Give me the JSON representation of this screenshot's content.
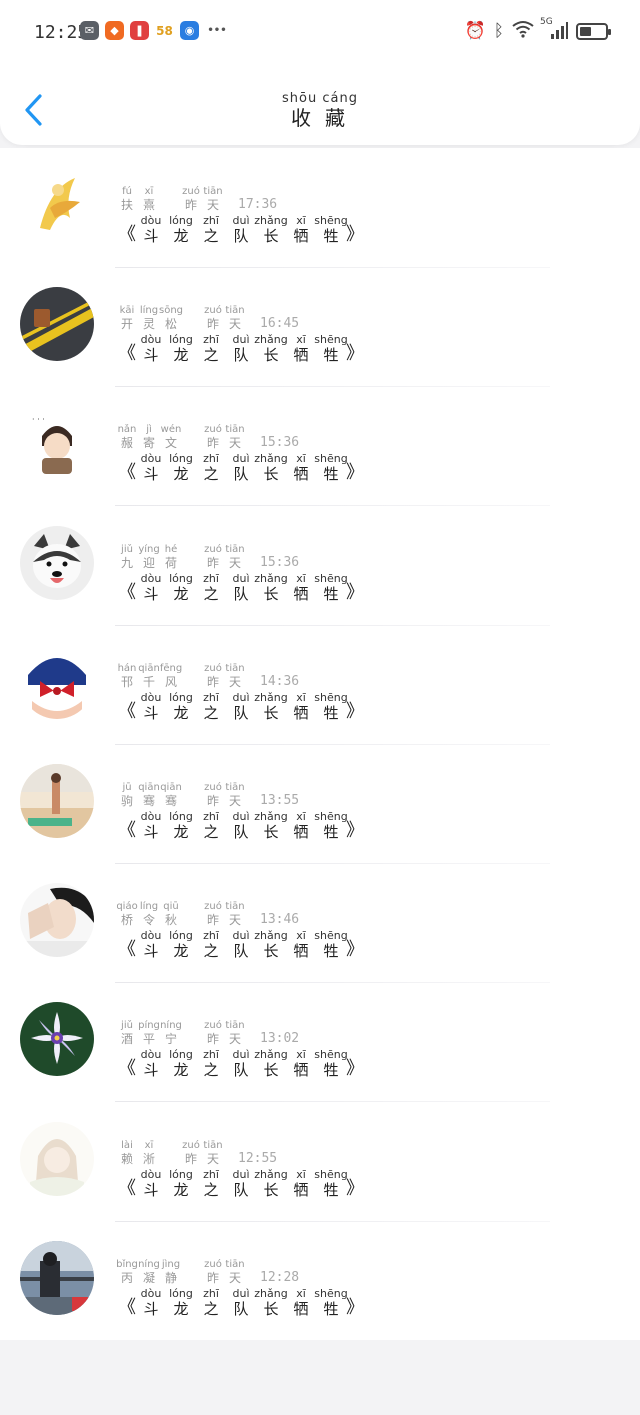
{
  "status_bar": {
    "time": "12:25",
    "left_icons": [
      {
        "name": "mail-app-icon",
        "glyph": "✉",
        "bg": "#5a5f66"
      },
      {
        "name": "kuaishou-app-icon",
        "glyph": "◆",
        "bg": "#f06a22"
      },
      {
        "name": "reader-app-icon",
        "glyph": "❚",
        "bg": "#e04040"
      },
      {
        "name": "58-app-icon",
        "glyph": "58",
        "bg": "#ffffff"
      },
      {
        "name": "bulb-app-icon",
        "glyph": "◉",
        "bg": "#2a7de1"
      },
      {
        "name": "more-dots-icon",
        "glyph": "•••",
        "bg": "transparent"
      }
    ],
    "right_icons": [
      "alarm-icon",
      "bluetooth-icon",
      "wifi-icon",
      "5g-signal-icon",
      "battery-icon"
    ],
    "network_label": "5G"
  },
  "header": {
    "title_pinyin": "shōu cáng",
    "title": "收藏"
  },
  "book": {
    "open": "《",
    "close": "》",
    "chars": [
      {
        "py": "dòu",
        "hz": "斗"
      },
      {
        "py": "lóng",
        "hz": "龙"
      },
      {
        "py": "zhī",
        "hz": "之"
      },
      {
        "py": "duì",
        "hz": "队"
      },
      {
        "py": "zhǎng",
        "hz": "长"
      },
      {
        "py": "xī",
        "hz": "牺"
      },
      {
        "py": "shēng",
        "hz": "牲"
      }
    ]
  },
  "yesterday": [
    {
      "py": "zuó",
      "hz": "昨"
    },
    {
      "py": "tiān",
      "hz": "天"
    }
  ],
  "items": [
    {
      "name": [
        {
          "py": "fú",
          "hz": "扶"
        },
        {
          "py": "xī",
          "hz": "熹"
        }
      ],
      "time": "17:36",
      "avatar": "gold-figure"
    },
    {
      "name": [
        {
          "py": "kāi",
          "hz": "开"
        },
        {
          "py": "líng",
          "hz": "灵"
        },
        {
          "py": "sōng",
          "hz": "松"
        }
      ],
      "time": "16:45",
      "avatar": "road-suitcase"
    },
    {
      "name": [
        {
          "py": "nǎn",
          "hz": "赧"
        },
        {
          "py": "jì",
          "hz": "寄"
        },
        {
          "py": "wén",
          "hz": "文"
        }
      ],
      "time": "15:36",
      "avatar": "cartoon-boy"
    },
    {
      "name": [
        {
          "py": "jiǔ",
          "hz": "九"
        },
        {
          "py": "yíng",
          "hz": "迎"
        },
        {
          "py": "hé",
          "hz": "荷"
        }
      ],
      "time": "15:36",
      "avatar": "husky-dog"
    },
    {
      "name": [
        {
          "py": "hán",
          "hz": "邗"
        },
        {
          "py": "qiān",
          "hz": "千"
        },
        {
          "py": "fēng",
          "hz": "风"
        }
      ],
      "time": "14:36",
      "avatar": "sailor-cartoon"
    },
    {
      "name": [
        {
          "py": "jū",
          "hz": "驹"
        },
        {
          "py": "qiān",
          "hz": "骞"
        },
        {
          "py": "qiān",
          "hz": "骞"
        }
      ],
      "time": "13:55",
      "avatar": "beach-person"
    },
    {
      "name": [
        {
          "py": "qiáo",
          "hz": "桥"
        },
        {
          "py": "líng",
          "hz": "令"
        },
        {
          "py": "qiū",
          "hz": "秋"
        }
      ],
      "time": "13:46",
      "avatar": "hand-over-face"
    },
    {
      "name": [
        {
          "py": "jiǔ",
          "hz": "酒"
        },
        {
          "py": "píng",
          "hz": "平"
        },
        {
          "py": "níng",
          "hz": "宁"
        }
      ],
      "time": "13:02",
      "avatar": "purple-flower"
    },
    {
      "name": [
        {
          "py": "lài",
          "hz": "赖"
        },
        {
          "py": "xī",
          "hz": "淅"
        }
      ],
      "time": "12:55",
      "avatar": "faded-girl"
    },
    {
      "name": [
        {
          "py": "bǐng",
          "hz": "丙"
        },
        {
          "py": "níng",
          "hz": "凝"
        },
        {
          "py": "jìng",
          "hz": "静"
        }
      ],
      "time": "12:28",
      "avatar": "girl-railing"
    }
  ]
}
